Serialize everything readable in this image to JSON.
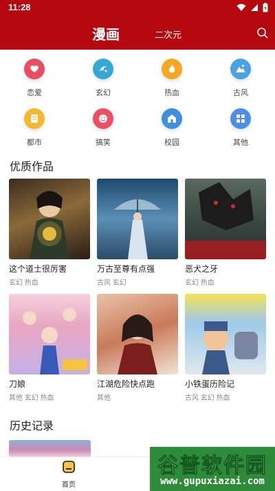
{
  "status_bar": {
    "time": "11:28"
  },
  "header": {
    "title": "漫画",
    "subtitle": "二次元"
  },
  "colors": {
    "brand_red": "#b5080f"
  },
  "categories": [
    {
      "label": "恋爱",
      "icon": "heart-icon",
      "color": "#e94d5f"
    },
    {
      "label": "玄幻",
      "icon": "magic-icon",
      "color": "#36a8d8"
    },
    {
      "label": "热血",
      "icon": "flame-icon",
      "color": "#f5a623"
    },
    {
      "label": "古风",
      "icon": "mountain-icon",
      "color": "#4aa3e0"
    },
    {
      "label": "都市",
      "icon": "document-icon",
      "color": "#f5b82e"
    },
    {
      "label": "搞笑",
      "icon": "smile-icon",
      "color": "#ee4d62"
    },
    {
      "label": "校园",
      "icon": "building-icon",
      "color": "#3f8fe0"
    },
    {
      "label": "其他",
      "icon": "grid-icon",
      "color": "#4d8fe6"
    }
  ],
  "quality_works": {
    "title": "优质作品",
    "items": [
      {
        "title": "这个道士很厉害",
        "tags": "玄幻 热血"
      },
      {
        "title": "万古至尊有点强",
        "tags": "古风 玄幻"
      },
      {
        "title": "恶犬之牙",
        "tags": "玄幻 热血"
      },
      {
        "title": "刀娘",
        "tags": "其他 玄幻 热血"
      },
      {
        "title": "江湖危险快点跑",
        "tags": "其他"
      },
      {
        "title": "小铁蛋历险记",
        "tags": "古风 玄幻 热血"
      }
    ]
  },
  "history": {
    "title": "历史记录"
  },
  "bottom_nav": {
    "home_label": "首页"
  },
  "watermark": {
    "cn": "谷普软件园",
    "url": "www.gupuxiazai.com"
  }
}
